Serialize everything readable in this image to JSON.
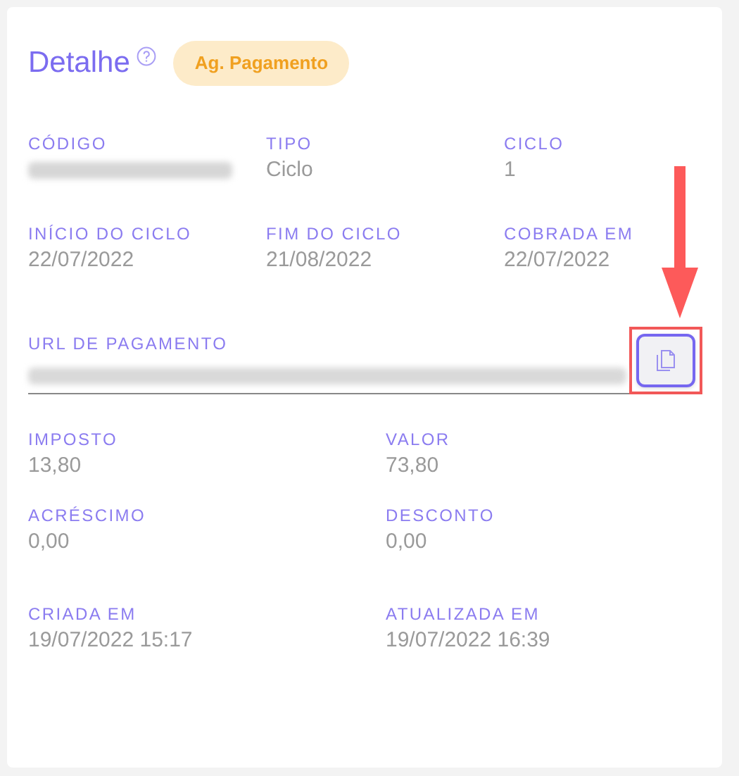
{
  "header": {
    "title": "Detalhe",
    "status": "Ag. Pagamento"
  },
  "cycle_fields": [
    {
      "label": "CÓDIGO",
      "redacted": true
    },
    {
      "label": "TIPO",
      "value": "Ciclo"
    },
    {
      "label": "CICLO",
      "value": "1"
    },
    {
      "label": "INÍCIO DO CICLO",
      "value": "22/07/2022"
    },
    {
      "label": "FIM DO CICLO",
      "value": "21/08/2022"
    },
    {
      "label": "COBRADA EM",
      "value": "22/07/2022"
    }
  ],
  "payment_url": {
    "label": "URL DE PAGAMENTO",
    "redacted": true,
    "highlighted": true
  },
  "amounts": [
    {
      "label": "IMPOSTO",
      "value": "13,80"
    },
    {
      "label": "VALOR",
      "value": "73,80"
    },
    {
      "label": "ACRÉSCIMO",
      "value": "0,00"
    },
    {
      "label": "DESCONTO",
      "value": "0,00"
    }
  ],
  "timestamps": [
    {
      "label": "CRIADA EM",
      "value": "19/07/2022 15:17"
    },
    {
      "label": "ATUALIZADA EM",
      "value": "19/07/2022 16:39"
    }
  ]
}
